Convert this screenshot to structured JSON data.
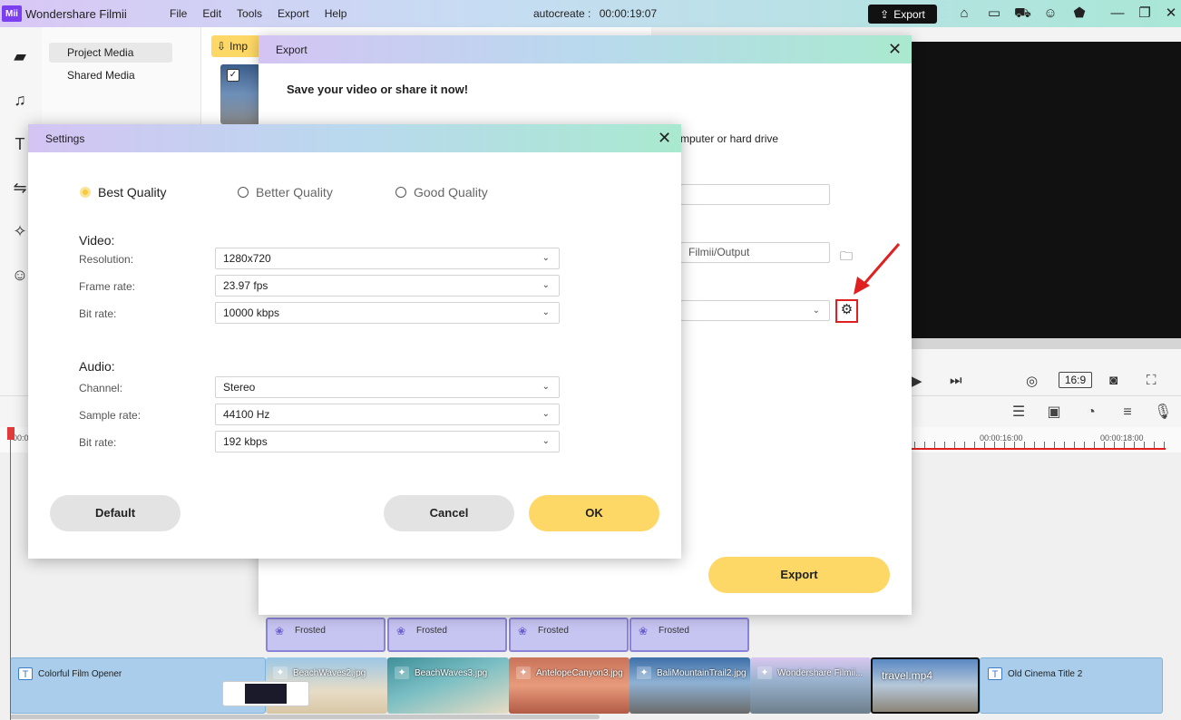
{
  "app": {
    "logo_text": "Mii",
    "title": "Wondershare Filmii",
    "menu": [
      "File",
      "Edit",
      "Tools",
      "Export",
      "Help"
    ],
    "project_label": "autocreate :",
    "project_time": "00:00:19:07",
    "export_button": "Export"
  },
  "sidebar": {
    "items": [
      "Project Media",
      "Shared Media"
    ]
  },
  "library": {
    "import_label": "Imp"
  },
  "preview": {
    "aspect_ratio": "16:9"
  },
  "timeline": {
    "ruler_labels": [
      "00:0",
      "00:00:16:00",
      "00:00:18:00"
    ],
    "effects": [
      "Frosted",
      "Frosted",
      "Frosted",
      "Frosted"
    ],
    "clips": [
      {
        "label": "Colorful Film Opener"
      },
      {
        "label": "BeachWaves2.jpg"
      },
      {
        "label": "BeachWaves3.jpg"
      },
      {
        "label": "AntelopeCanyon3.jpg"
      },
      {
        "label": "BaliMountainTrail2.jpg"
      },
      {
        "label": "Wondershare Filmii..."
      },
      {
        "label": "travel.mp4"
      },
      {
        "label": "Old Cinema Title 2"
      }
    ]
  },
  "export_dialog": {
    "title": "Export",
    "subtitle": "Save your video or share it now!",
    "save_to_text": "mputer or hard drive",
    "output_path": "Filmii/Output",
    "export_button": "Export"
  },
  "settings_dialog": {
    "title": "Settings",
    "quality_options": [
      "Best Quality",
      "Better Quality",
      "Good Quality"
    ],
    "selected_quality": "Best Quality",
    "video_section": "Video:",
    "audio_section": "Audio:",
    "video": {
      "resolution_label": "Resolution:",
      "resolution": "1280x720",
      "frame_rate_label": "Frame rate:",
      "frame_rate": "23.97 fps",
      "bit_rate_label": "Bit rate:",
      "bit_rate": "10000 kbps"
    },
    "audio": {
      "channel_label": "Channel:",
      "channel": "Stereo",
      "sample_rate_label": "Sample rate:",
      "sample_rate": "44100 Hz",
      "bit_rate_label": "Bit rate:",
      "bit_rate": "192 kbps"
    },
    "buttons": {
      "default": "Default",
      "cancel": "Cancel",
      "ok": "OK"
    }
  },
  "colors": {
    "accent_yellow": "#fdd866",
    "highlight_red": "#e02020"
  }
}
